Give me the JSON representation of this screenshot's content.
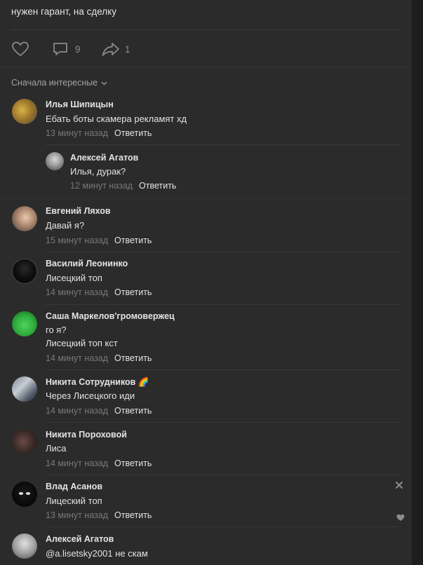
{
  "post": {
    "text": "нужен гарант, на сделку",
    "likes": "",
    "comments_count": "9",
    "shares_count": "1"
  },
  "sort_label": "Сначала интересные",
  "reply_label": "Ответить",
  "comments": [
    {
      "name": "Илья Шипицын",
      "lines": [
        "Ебать боты скамера рекламят хд"
      ],
      "time": "13 минут назад"
    },
    {
      "name": "Алексей Агатов",
      "lines": [
        "Илья, дурак?"
      ],
      "time": "12 минут назад"
    },
    {
      "name": "Евгений Ляхов",
      "lines": [
        "Давай я?"
      ],
      "time": "15 минут назад"
    },
    {
      "name": "Василий Леонинко",
      "lines": [
        "Лисецкий топ"
      ],
      "time": "14 минут назад"
    },
    {
      "name": "Саша Маркелов'громовержец",
      "lines": [
        "го я?",
        "Лисецкий топ кст"
      ],
      "time": "14 минут назад"
    },
    {
      "name": "Никита Сотрудников 🌈",
      "lines": [
        "Через Лисецкого иди"
      ],
      "time": "14 минут назад"
    },
    {
      "name": "Никита Пороховой",
      "lines": [
        "Лиса"
      ],
      "time": "14 минут назад"
    },
    {
      "name": "Влад Асанов",
      "lines": [
        "Лицеский топ"
      ],
      "time": "13 минут назад"
    },
    {
      "name": "Алексей Агатов",
      "lines": [
        "@a.lisetsky2001 не скам"
      ],
      "time": ""
    }
  ],
  "colors": {
    "background": "#2b2b2b",
    "text": "#e1e3e6",
    "muted": "#76787a",
    "icon": "#8a8d91"
  }
}
